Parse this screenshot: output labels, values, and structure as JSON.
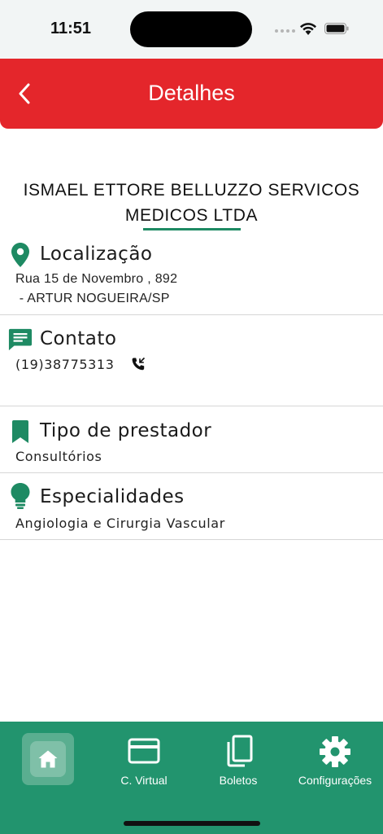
{
  "status_bar": {
    "time": "11:51"
  },
  "header": {
    "title": "Detalhes",
    "background_color": "#e4262b",
    "back_icon": "chevron-left-icon"
  },
  "provider": {
    "name": "ISMAEL ETTORE BELLUZZO SERVICOS MEDICOS LTDA"
  },
  "sections": {
    "location": {
      "icon": "location-pin-icon",
      "title": "Localização",
      "line1": "Rua 15 de Novembro , 892",
      "line2": " - ARTUR NOGUEIRA/SP"
    },
    "contact": {
      "icon": "message-icon",
      "title": "Contato",
      "phone": "(19)38775313",
      "phone_icon": "phone-call-icon"
    },
    "provider_type": {
      "icon": "bookmark-icon",
      "title": "Tipo de prestador",
      "value": "Consultórios"
    },
    "specialties": {
      "icon": "lightbulb-icon",
      "title": "Especialidades",
      "value": "Angiologia e Cirurgia Vascular"
    }
  },
  "bottom_nav": {
    "background_color": "#22946e",
    "items": [
      {
        "label": "",
        "icon": "home-icon",
        "active": true
      },
      {
        "label": "C. Virtual",
        "icon": "card-icon",
        "active": false
      },
      {
        "label": "Boletos",
        "icon": "documents-icon",
        "active": false
      },
      {
        "label": "Configurações",
        "icon": "gear-icon",
        "active": false
      }
    ]
  },
  "accent_color": "#1e8a63"
}
